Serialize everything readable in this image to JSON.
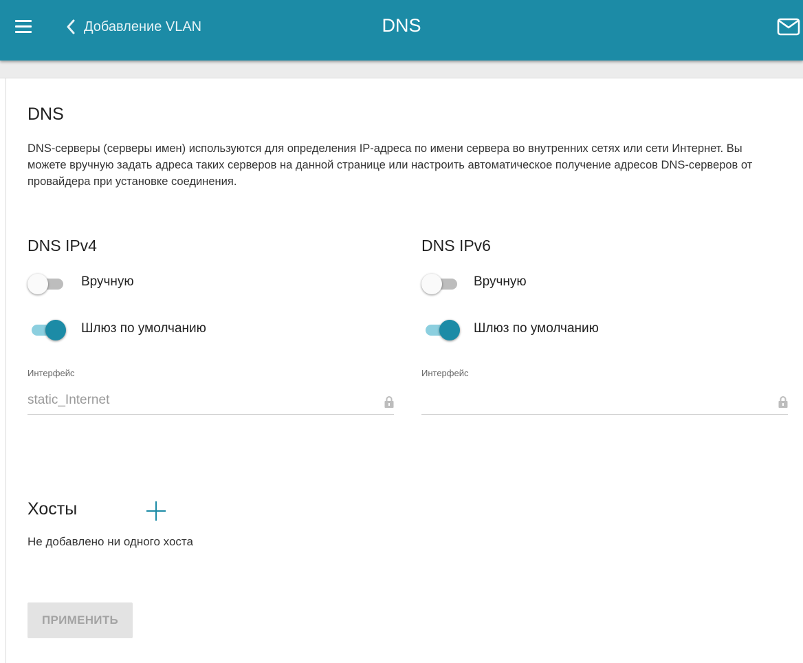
{
  "header": {
    "back_label": "Добавление VLAN",
    "title": "DNS",
    "color": "#1c8ba6",
    "icons": {
      "menu": "menu-icon",
      "back": "chevron-left-icon",
      "mail": "mail-icon"
    }
  },
  "main": {
    "title": "DNS",
    "description": "DNS-серверы (серверы имен) используются для определения IP-адреса по имени сервера во внутренних сетях или сети Интернет. Вы можете вручную задать адреса таких серверов на данной странице или настроить автоматическое получение адресов DNS-серверов от провайдера при установке соединения."
  },
  "ipv4": {
    "title": "DNS IPv4",
    "manual": {
      "label": "Вручную",
      "on": false
    },
    "gateway": {
      "label": "Шлюз по умолчанию",
      "on": true
    },
    "interface": {
      "label": "Интерфейс",
      "value": "static_Internet",
      "locked": true
    }
  },
  "ipv6": {
    "title": "DNS IPv6",
    "manual": {
      "label": "Вручную",
      "on": false
    },
    "gateway": {
      "label": "Шлюз по умолчанию",
      "on": true
    },
    "interface": {
      "label": "Интерфейс",
      "value": "",
      "locked": true
    }
  },
  "hosts": {
    "title": "Хосты",
    "empty_text": "Не добавлено ни одного хоста",
    "add_icon": "plus-icon"
  },
  "apply_label": "ПРИМЕНИТЬ",
  "colors": {
    "accent": "#1c8ba6",
    "toggle_track_on": "#8ccfdf",
    "toggle_off": "#bdbdbd"
  }
}
